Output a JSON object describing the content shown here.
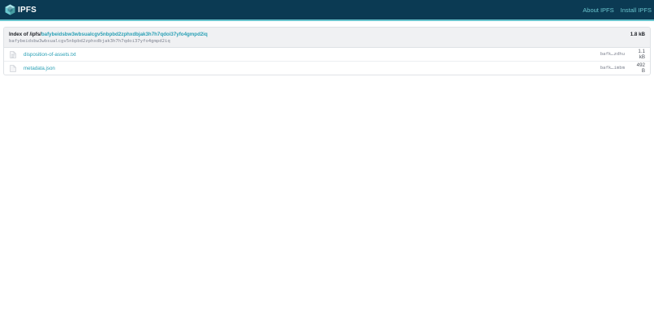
{
  "header": {
    "brand": "IPFS",
    "nav": [
      "About IPFS",
      "Install IPFS"
    ]
  },
  "index": {
    "prefix": "Index of /ipfs/",
    "cid": "bafybeidsbw3wbsualcgv5nbpbd2zphxdbjak3h7h7qdoi37yfo4gmpd2iq",
    "total_size": "1.8 kB"
  },
  "files": [
    {
      "name": "disposition-of-assets.txt",
      "cid": "bafk…zdhu",
      "size": "1.1 kB",
      "icon": "file-text-icon"
    },
    {
      "name": "metadata.json",
      "cid": "bafk…imbm",
      "size": "492 B",
      "icon": "file-icon"
    }
  ],
  "colors": {
    "topbar": "#0b3a53",
    "accent": "#69c4cd",
    "link": "#2aa0b5"
  }
}
